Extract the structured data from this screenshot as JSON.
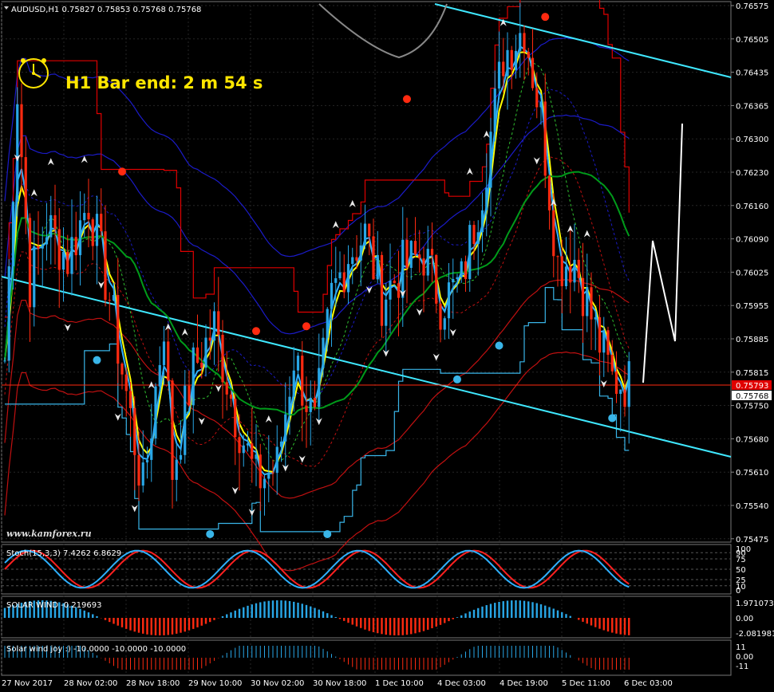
{
  "colors": {
    "up": "#28a6e6",
    "down": "#ff2a10",
    "ema_fast": "#ffff00",
    "ema_green": "#009b1a",
    "cyan": "#3fe8ff",
    "envelope_blue": "#1b1bc8",
    "envelope_red": "#c01010",
    "stair_red": "#e00000",
    "stair_blue": "#39b5e8",
    "grid": "#262626"
  },
  "main": {
    "header": "AUDUSD,H1  0.75827 0.75853 0.75768 0.75768",
    "timer": "H1 Bar end: 2 m 54 s",
    "watermark": "www.kamforex.ru",
    "price_ticks": [
      "0.76575",
      "0.76505",
      "0.76435",
      "0.76365",
      "0.76300",
      "0.76230",
      "0.76160",
      "0.76090",
      "0.76025",
      "0.75955",
      "0.75885",
      "0.75815",
      "0.75750",
      "0.75680",
      "0.75610",
      "0.75540",
      "0.75475"
    ],
    "ref_price": "0.75793",
    "last_price": "0.75768"
  },
  "time_ticks": [
    "27 Nov 2017",
    "28 Nov 02:00",
    "28 Nov 18:00",
    "29 Nov 10:00",
    "30 Nov 02:00",
    "30 Nov 18:00",
    "1 Dec 10:00",
    "4 Dec 03:00",
    "4 Dec 19:00",
    "5 Dec 11:00",
    "6 Dec 03:00"
  ],
  "sub1": {
    "label": "Stoch(15,3,3) 7.4262 6.8629",
    "ticks": [
      "100",
      "90",
      "75",
      "50",
      "25",
      "10",
      "0"
    ]
  },
  "sub2": {
    "label": "SOLAR WIND -0.219693",
    "ticks": [
      "1.971073",
      "0.00",
      "-2.081981"
    ]
  },
  "sub3": {
    "label": "Solar wind joy :) -10.0000 -10.0000 -10.0000",
    "ticks": [
      "11",
      "0.00",
      "-11"
    ]
  },
  "chart_data": [
    {
      "type": "candlestick",
      "symbol": "AUDUSD",
      "timeframe": "H1",
      "ylim": [
        0.75475,
        0.76575
      ],
      "last_bar": {
        "open": 0.75827,
        "high": 0.75853,
        "low": 0.75768,
        "close": 0.75768
      },
      "ref_line": 0.75793,
      "price_path": [
        [
          0,
          0.7584
        ],
        [
          3,
          0.764
        ],
        [
          6,
          0.76
        ],
        [
          10,
          0.7612
        ],
        [
          15,
          0.7605
        ],
        [
          20,
          0.7617
        ],
        [
          25,
          0.7597
        ],
        [
          28,
          0.7582
        ],
        [
          33,
          0.7557
        ],
        [
          38,
          0.7592
        ],
        [
          40,
          0.7561
        ],
        [
          45,
          0.7582
        ],
        [
          50,
          0.7591
        ],
        [
          55,
          0.7573
        ],
        [
          60,
          0.7559
        ],
        [
          65,
          0.7562
        ],
        [
          69,
          0.7585
        ],
        [
          74,
          0.757
        ],
        [
          78,
          0.7597
        ],
        [
          82,
          0.7606
        ],
        [
          86,
          0.761
        ],
        [
          90,
          0.7597
        ],
        [
          95,
          0.7603
        ],
        [
          100,
          0.7606
        ],
        [
          104,
          0.7596
        ],
        [
          109,
          0.76
        ],
        [
          114,
          0.762
        ],
        [
          119,
          0.7647
        ],
        [
          124,
          0.7653
        ],
        [
          128,
          0.7634
        ],
        [
          132,
          0.7604
        ],
        [
          136,
          0.7605
        ],
        [
          141,
          0.759
        ],
        [
          145,
          0.758
        ],
        [
          150,
          0.7579
        ]
      ]
    },
    {
      "type": "line",
      "name": "Stoch",
      "ylim": [
        0,
        100
      ]
    },
    {
      "type": "bar",
      "name": "SOLAR WIND",
      "ylim": [
        -2.081981,
        1.971073
      ]
    },
    {
      "type": "bar",
      "name": "Solar wind joy",
      "ylim": [
        -11,
        11
      ]
    }
  ]
}
